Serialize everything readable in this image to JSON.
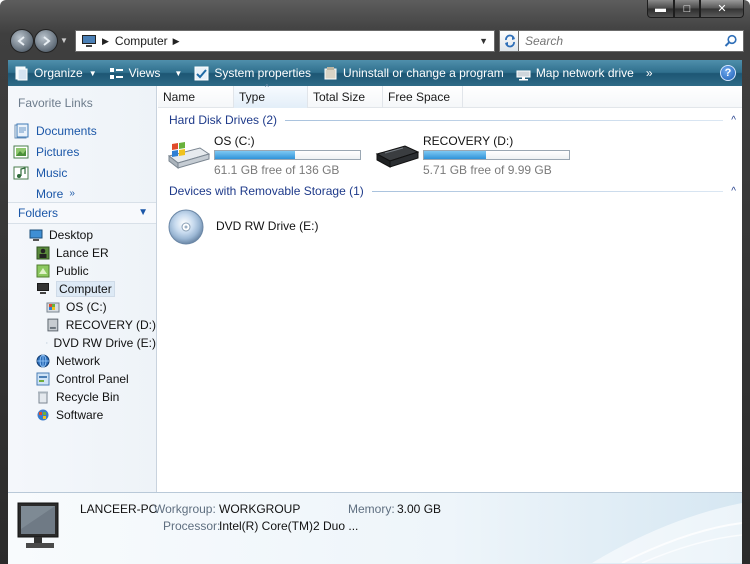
{
  "window": {
    "caption_buttons": {
      "minimize": "▬",
      "maximize": "□",
      "close": "✕"
    }
  },
  "address_bar": {
    "crumbs": [
      "Computer"
    ],
    "separator": "▶",
    "search_placeholder": "Search"
  },
  "command_bar": {
    "items": [
      {
        "label": "Organize",
        "icon": "organize-icon",
        "has_dropdown": true
      },
      {
        "label": "Views",
        "icon": "views-icon",
        "has_dropdown": true
      },
      {
        "label": "System properties",
        "icon": "system-properties-icon"
      },
      {
        "label": "Uninstall or change a program",
        "icon": "uninstall-icon"
      },
      {
        "label": "Map network drive",
        "icon": "map-network-drive-icon"
      }
    ],
    "overflow": "»",
    "help": "?"
  },
  "nav_pane": {
    "favorite_links_title": "Favorite Links",
    "favorites": [
      {
        "label": "Documents",
        "icon": "documents-icon"
      },
      {
        "label": "Pictures",
        "icon": "pictures-icon"
      },
      {
        "label": "Music",
        "icon": "music-icon"
      }
    ],
    "more_label": "More",
    "more_chevron": "»",
    "folders_title": "Folders",
    "folders_chevron": "▼",
    "tree": [
      {
        "label": "Desktop",
        "icon": "desktop-icon",
        "level": 0
      },
      {
        "label": "Lance ER",
        "icon": "user-folder-icon",
        "level": 1
      },
      {
        "label": "Public",
        "icon": "public-folder-icon",
        "level": 1
      },
      {
        "label": "Computer",
        "icon": "computer-icon",
        "level": 1,
        "selected": true
      },
      {
        "label": "OS (C:)",
        "icon": "os-drive-icon",
        "level": 2
      },
      {
        "label": "RECOVERY (D:)",
        "icon": "hard-drive-icon",
        "level": 2
      },
      {
        "label": "DVD RW Drive (E:)",
        "icon": "dvd-drive-icon",
        "level": 2
      },
      {
        "label": "Network",
        "icon": "network-icon",
        "level": 1
      },
      {
        "label": "Control Panel",
        "icon": "control-panel-icon",
        "level": 1
      },
      {
        "label": "Recycle Bin",
        "icon": "recycle-bin-icon",
        "level": 1
      },
      {
        "label": "Software",
        "icon": "software-icon",
        "level": 1
      }
    ]
  },
  "columns": [
    "Name",
    "Type",
    "Total Size",
    "Free Space"
  ],
  "sort_caret": "^",
  "groups": {
    "hard_disk": {
      "title": "Hard Disk Drives (2)",
      "chevron": "^",
      "drives": [
        {
          "name": "OS (C:)",
          "free_text": "61.1 GB free of 136 GB",
          "used_fraction": 0.55,
          "icon": "os-drive-icon"
        },
        {
          "name": "RECOVERY (D:)",
          "free_text": "5.71 GB free of 9.99 GB",
          "used_fraction": 0.43,
          "icon": "hard-drive-icon"
        }
      ]
    },
    "removable": {
      "title": "Devices with Removable Storage (1)",
      "chevron": "^",
      "devices": [
        {
          "name": "DVD RW Drive (E:)",
          "icon": "dvd-drive-icon"
        }
      ]
    }
  },
  "details": {
    "computer_name": "LANCEER-PC",
    "workgroup_label": "Workgroup:",
    "workgroup_value": "WORKGROUP",
    "memory_label": "Memory:",
    "memory_value": "3.00 GB",
    "processor_label": "Processor:",
    "processor_value": "Intel(R) Core(TM)2 Duo ..."
  }
}
